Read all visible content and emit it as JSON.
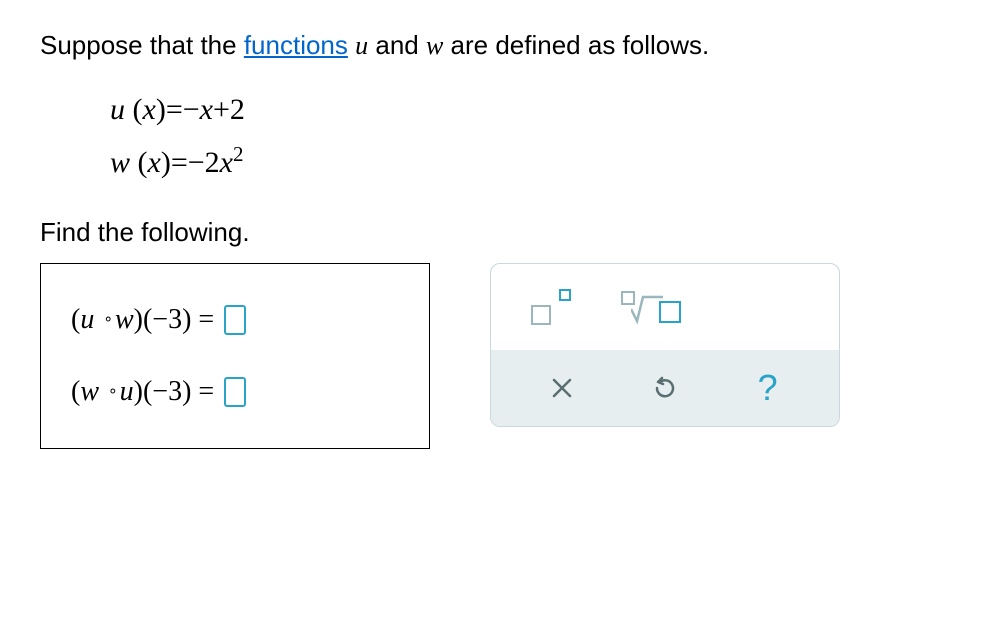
{
  "problem": {
    "intro_pre": "Suppose that the ",
    "link_text": "functions",
    "intro_mid": " ",
    "var_u": "u",
    "intro_and": " and ",
    "var_w": "w",
    "intro_post": " are defined as follows."
  },
  "functions": {
    "u_def": "u (x) = −x + 2",
    "w_def_base": "w (x) = −2x",
    "w_def_exp": "2"
  },
  "instruction": "Find the following.",
  "answers": {
    "line1_lhs": "(u  ∘ w)(−3) = ",
    "line2_lhs": "(w  ∘ u)(−3) = "
  },
  "toolbox": {
    "exponent_btn": "exponent",
    "root_btn": "nth-root",
    "clear_btn": "clear",
    "reset_btn": "reset",
    "help_btn": "help",
    "help_symbol": "?"
  }
}
